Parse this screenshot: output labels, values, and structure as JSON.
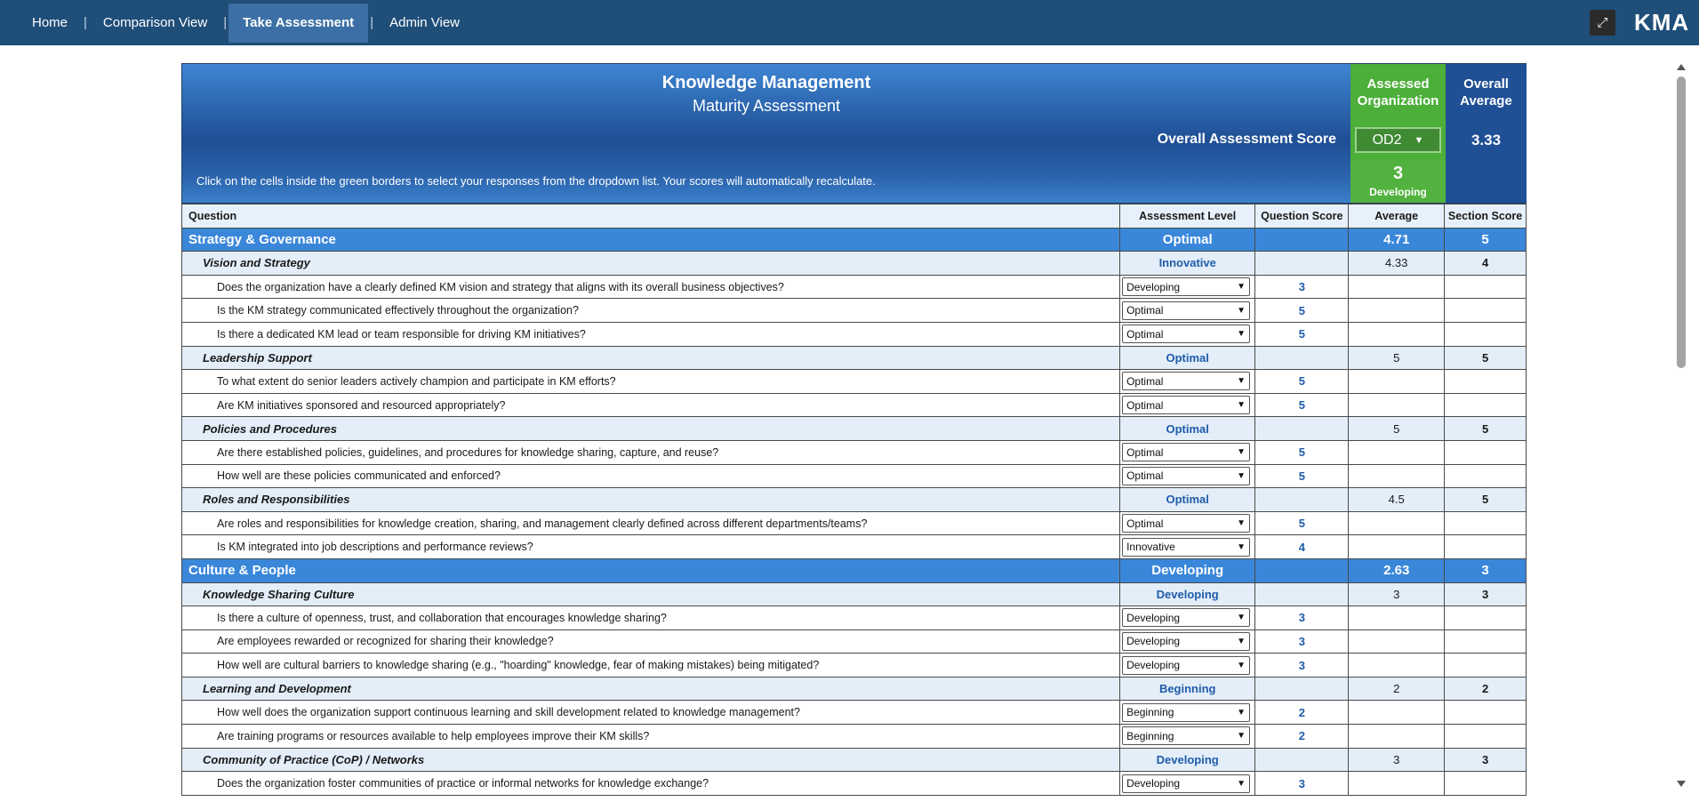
{
  "nav": {
    "items": [
      {
        "label": "Home"
      },
      {
        "label": "Comparison View"
      },
      {
        "label": "Take Assessment"
      },
      {
        "label": "Admin View"
      }
    ],
    "separator": "|",
    "expand_icon": "⤢",
    "brand": "KMA"
  },
  "header": {
    "title": "Knowledge Management",
    "subtitle": "Maturity Assessment",
    "assessed_org_label_1": "Assessed",
    "assessed_org_label_2": "Organization",
    "overall_avg_label_1": "Overall",
    "overall_avg_label_2": "Average",
    "overall_score_label": "Overall Assessment Score",
    "org_selected": "OD2",
    "org_score": "3",
    "org_level": "Developing",
    "overall_average": "3.33",
    "instructions": "Click on the cells inside the green borders to select your responses from the dropdown list. Your scores will automatically recalculate."
  },
  "columns": {
    "question": "Question",
    "level": "Assessment Level",
    "score": "Question Score",
    "average": "Average",
    "section": "Section Score"
  },
  "rows": [
    {
      "type": "section",
      "name": "Strategy & Governance",
      "level": "Optimal",
      "average": "4.71",
      "section": "5"
    },
    {
      "type": "sub",
      "name": "Vision and Strategy",
      "level": "Innovative",
      "average": "4.33",
      "section": "4"
    },
    {
      "type": "q",
      "name": "Does the organization have a clearly defined KM vision and strategy that aligns with its overall business objectives?",
      "level": "Developing",
      "score": "3"
    },
    {
      "type": "q",
      "name": "Is the KM strategy communicated effectively throughout the organization?",
      "level": "Optimal",
      "score": "5"
    },
    {
      "type": "q",
      "name": "Is there a dedicated KM lead or team responsible for driving KM initiatives?",
      "level": "Optimal",
      "score": "5"
    },
    {
      "type": "sub",
      "name": "Leadership Support",
      "level": "Optimal",
      "average": "5",
      "section": "5"
    },
    {
      "type": "q",
      "name": "To what extent do senior leaders actively champion and participate in KM efforts?",
      "level": "Optimal",
      "score": "5"
    },
    {
      "type": "q",
      "name": "Are KM initiatives sponsored and resourced appropriately?",
      "level": "Optimal",
      "score": "5"
    },
    {
      "type": "sub",
      "name": "Policies and Procedures",
      "level": "Optimal",
      "average": "5",
      "section": "5"
    },
    {
      "type": "q",
      "name": "Are there established policies, guidelines, and procedures for knowledge sharing, capture, and reuse?",
      "level": "Optimal",
      "score": "5"
    },
    {
      "type": "q",
      "name": "How well are these policies communicated and enforced?",
      "level": "Optimal",
      "score": "5"
    },
    {
      "type": "sub",
      "name": "Roles and Responsibilities",
      "level": "Optimal",
      "average": "4.5",
      "section": "5"
    },
    {
      "type": "q",
      "name": "Are roles and responsibilities for knowledge creation, sharing, and management clearly defined across different departments/teams?",
      "level": "Optimal",
      "score": "5"
    },
    {
      "type": "q",
      "name": "Is KM integrated into job descriptions and performance reviews?",
      "level": "Innovative",
      "score": "4"
    },
    {
      "type": "section",
      "name": "Culture & People",
      "level": "Developing",
      "average": "2.63",
      "section": "3"
    },
    {
      "type": "sub",
      "name": "Knowledge Sharing Culture",
      "level": "Developing",
      "average": "3",
      "section": "3"
    },
    {
      "type": "q",
      "name": "Is there a culture of openness, trust, and collaboration that encourages knowledge sharing?",
      "level": "Developing",
      "score": "3"
    },
    {
      "type": "q",
      "name": "Are employees rewarded or recognized for sharing their knowledge?",
      "level": "Developing",
      "score": "3"
    },
    {
      "type": "q",
      "name": "How well are cultural barriers to knowledge sharing (e.g., \"hoarding\" knowledge, fear of making mistakes) being mitigated?",
      "level": "Developing",
      "score": "3"
    },
    {
      "type": "sub",
      "name": "Learning and Development",
      "level": "Beginning",
      "average": "2",
      "section": "2"
    },
    {
      "type": "q",
      "name": "How well does the organization support continuous learning and skill development related to knowledge management?",
      "level": "Beginning",
      "score": "2"
    },
    {
      "type": "q",
      "name": "Are training programs or resources available to help employees improve their KM skills?",
      "level": "Beginning",
      "score": "2"
    },
    {
      "type": "sub",
      "name": "Community of Practice (CoP) / Networks",
      "level": "Developing",
      "average": "3",
      "section": "3"
    },
    {
      "type": "q",
      "name": "Does the organization foster communities of practice or informal networks for knowledge exchange?",
      "level": "Developing",
      "score": "3"
    }
  ]
}
